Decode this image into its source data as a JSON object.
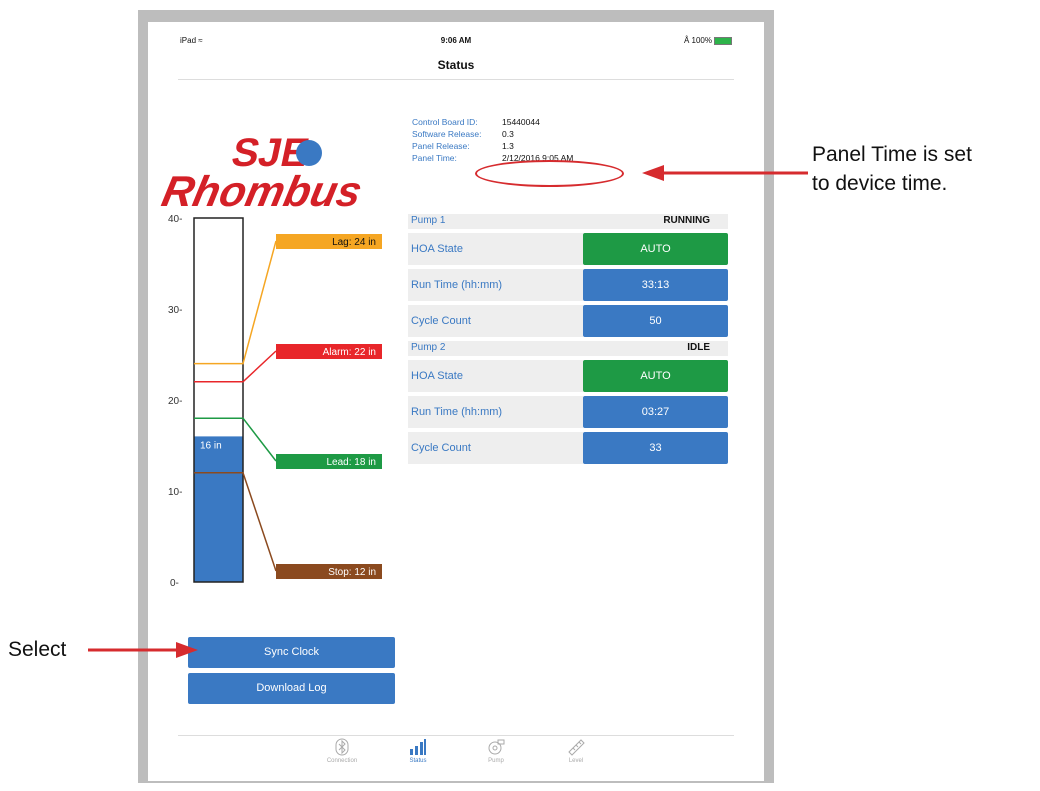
{
  "status_bar": {
    "device": "iPad",
    "time": "9:06 AM",
    "battery": "100%"
  },
  "nav": {
    "title": "Status"
  },
  "logo": {
    "line1": "SJE",
    "line2": "Rhombus"
  },
  "info": [
    {
      "label": "Control Board ID:",
      "value": "15440044"
    },
    {
      "label": "Software Release:",
      "value": "0.3"
    },
    {
      "label": "Panel Release:",
      "value": "1.3"
    },
    {
      "label": "Panel Time:",
      "value": "2/12/2016 9:05 AM"
    }
  ],
  "gauge": {
    "level_value": 16,
    "level_label": "16 in",
    "ticks": [
      "0-",
      "10-",
      "20-",
      "30-",
      "40-"
    ],
    "lag_label": "Lag: 24 in",
    "alarm_label": "Alarm: 22 in",
    "lead_label": "Lead: 18 in",
    "stop_label": "Stop: 12 in",
    "colors": {
      "lag": "#f5a623",
      "alarm": "#e8262a",
      "lead": "#1e9a45",
      "stop": "#8b4a1f",
      "fill": "#3a79c3"
    }
  },
  "pump1": {
    "name": "Pump 1",
    "state": "RUNNING",
    "hoa_label": "HOA State",
    "hoa": "AUTO",
    "run_label": "Run Time (hh:mm)",
    "run": "33:13",
    "cycle_label": "Cycle Count",
    "cycle": "50"
  },
  "pump2": {
    "name": "Pump 2",
    "state": "IDLE",
    "hoa_label": "HOA State",
    "hoa": "AUTO",
    "run_label": "Run Time (hh:mm)",
    "run": "03:27",
    "cycle_label": "Cycle Count",
    "cycle": "33"
  },
  "buttons": {
    "sync": "Sync Clock",
    "download": "Download Log"
  },
  "tabs": {
    "connection": "Connection",
    "status": "Status",
    "pump": "Pump",
    "level": "Level"
  },
  "annotations": {
    "panel_time_line1": "Panel Time is set",
    "panel_time_line2": "to device time.",
    "select": "Select"
  },
  "colors": {
    "accent": "#3a79c3",
    "green": "#1e9a45",
    "arrow": "#d62b2e"
  }
}
